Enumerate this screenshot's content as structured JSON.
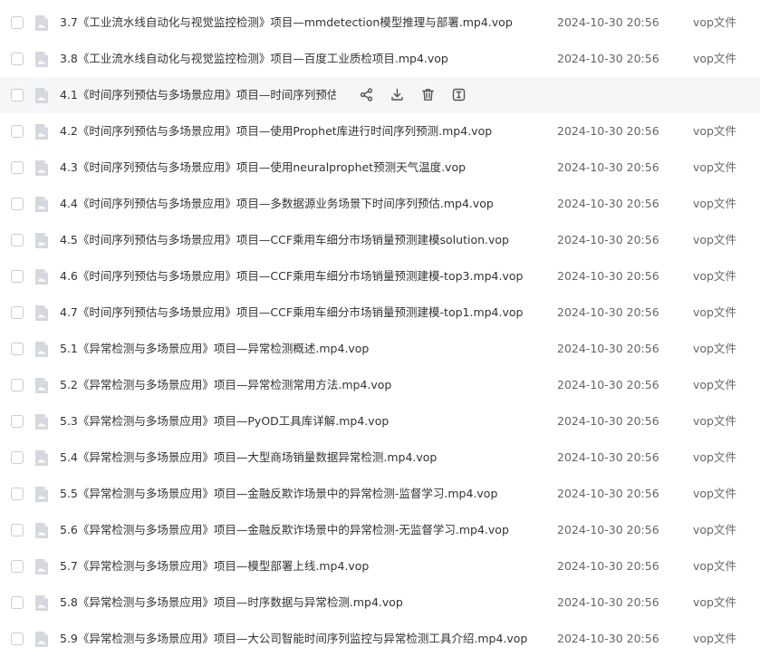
{
  "files": [
    {
      "name": "3.7《工业流水线自动化与视觉监控检测》项目—mmdetection模型推理与部署.mp4.vop",
      "date": "2024-10-30 20:56",
      "type": "vop文件"
    },
    {
      "name": "3.8《工业流水线自动化与视觉监控检测》项目—百度工业质检项目.mp4.vop",
      "date": "2024-10-30 20:56",
      "type": "vop文件"
    },
    {
      "name": "4.1《时间序列预估与多场景应用》项目—时间序列预估...",
      "date": "",
      "type": "",
      "hovered": true
    },
    {
      "name": "4.2《时间序列预估与多场景应用》项目—使用Prophet库进行时间序列预测.mp4.vop",
      "date": "2024-10-30 20:56",
      "type": "vop文件"
    },
    {
      "name": "4.3《时间序列预估与多场景应用》项目—使用neuralprophet预测天气温度.vop",
      "date": "2024-10-30 20:56",
      "type": "vop文件"
    },
    {
      "name": "4.4《时间序列预估与多场景应用》项目—多数据源业务场景下时间序列预估.mp4.vop",
      "date": "2024-10-30 20:56",
      "type": "vop文件"
    },
    {
      "name": "4.5《时间序列预估与多场景应用》项目—CCF乘用车细分市场销量预测建模solution.vop",
      "date": "2024-10-30 20:56",
      "type": "vop文件"
    },
    {
      "name": "4.6《时间序列预估与多场景应用》项目—CCF乘用车细分市场销量预测建模-top3.mp4.vop",
      "date": "2024-10-30 20:56",
      "type": "vop文件"
    },
    {
      "name": "4.7《时间序列预估与多场景应用》项目—CCF乘用车细分市场销量预测建模-top1.mp4.vop",
      "date": "2024-10-30 20:56",
      "type": "vop文件"
    },
    {
      "name": "5.1《异常检测与多场景应用》项目—异常检测概述.mp4.vop",
      "date": "2024-10-30 20:56",
      "type": "vop文件"
    },
    {
      "name": "5.2《异常检测与多场景应用》项目—异常检测常用方法.mp4.vop",
      "date": "2024-10-30 20:56",
      "type": "vop文件"
    },
    {
      "name": "5.3《异常检测与多场景应用》项目—PyOD工具库详解.mp4.vop",
      "date": "2024-10-30 20:56",
      "type": "vop文件"
    },
    {
      "name": "5.4《异常检测与多场景应用》项目—大型商场销量数据异常检测.mp4.vop",
      "date": "2024-10-30 20:56",
      "type": "vop文件"
    },
    {
      "name": "5.5《异常检测与多场景应用》项目—金融反欺诈场景中的异常检测-监督学习.mp4.vop",
      "date": "2024-10-30 20:56",
      "type": "vop文件"
    },
    {
      "name": "5.6《异常检测与多场景应用》项目—金融反欺诈场景中的异常检测-无监督学习.mp4.vop",
      "date": "2024-10-30 20:56",
      "type": "vop文件"
    },
    {
      "name": "5.7《异常检测与多场景应用》项目—模型部署上线.mp4.vop",
      "date": "2024-10-30 20:56",
      "type": "vop文件"
    },
    {
      "name": "5.8《异常检测与多场景应用》项目—时序数据与异常检测.mp4.vop",
      "date": "2024-10-30 20:56",
      "type": "vop文件"
    },
    {
      "name": "5.9《异常检测与多场景应用》项目—大公司智能时间序列监控与异常检测工具介绍.mp4.vop",
      "date": "2024-10-30 20:56",
      "type": "vop文件"
    }
  ],
  "row_actions": [
    {
      "icon": "share-icon"
    },
    {
      "icon": "download-icon"
    },
    {
      "icon": "trash-icon"
    },
    {
      "icon": "rename-icon"
    }
  ],
  "colors": {
    "hover_row_bg": "#f5f6f8",
    "icon_gray": "#555555",
    "file_icon_gray": "#d5d8dd"
  }
}
